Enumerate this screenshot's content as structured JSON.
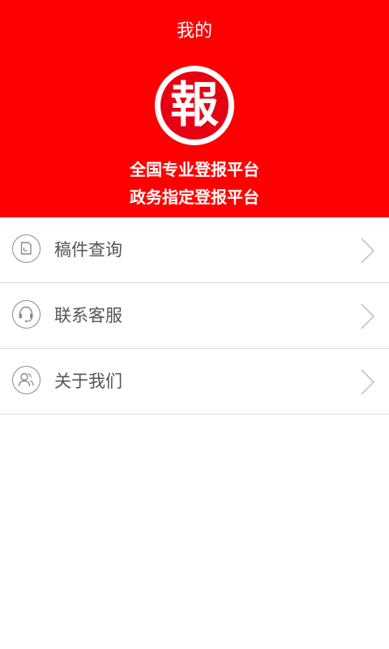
{
  "header": {
    "title": "我的",
    "logo_char": "報",
    "slogan_line1": "全国专业登报平台",
    "slogan_line2": "政务指定登报平台",
    "background_color": "#ff0000"
  },
  "menu": {
    "items": [
      {
        "label": "稿件查询",
        "icon": "document-icon"
      },
      {
        "label": "联系客服",
        "icon": "headset-icon"
      },
      {
        "label": "关于我们",
        "icon": "users-icon"
      }
    ]
  }
}
